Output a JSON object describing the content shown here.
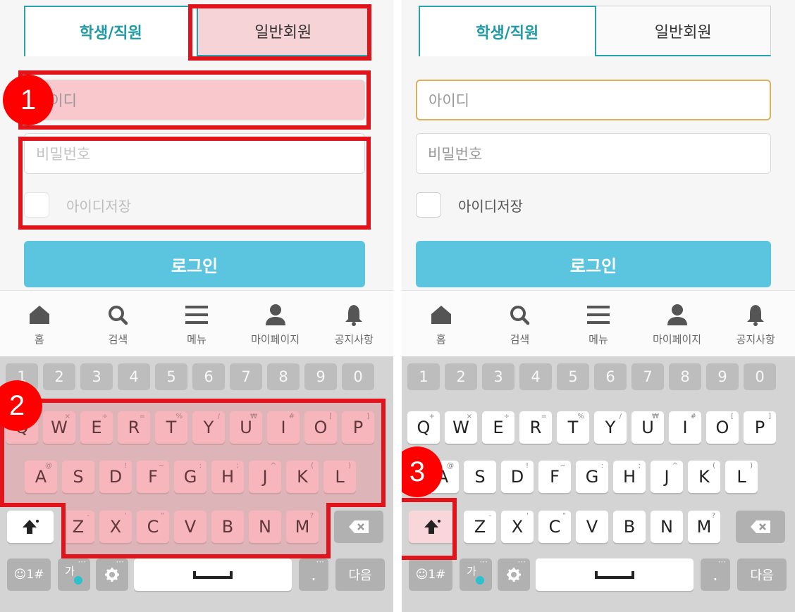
{
  "tabs": {
    "student": "학생/직원",
    "general": "일반회원"
  },
  "login": {
    "id_placeholder": "아이디",
    "pw_placeholder": "비밀번호",
    "save_id_label": "아이디저장",
    "login_button": "로그인"
  },
  "nav": [
    {
      "label": "홈",
      "icon": "home-icon"
    },
    {
      "label": "검색",
      "icon": "search-icon"
    },
    {
      "label": "메뉴",
      "icon": "menu-icon"
    },
    {
      "label": "마이페이지",
      "icon": "person-icon"
    },
    {
      "label": "공지사항",
      "icon": "bell-icon"
    }
  ],
  "keyboard": {
    "numbers": [
      "1",
      "2",
      "3",
      "4",
      "5",
      "6",
      "7",
      "8",
      "9",
      "0"
    ],
    "row1": [
      "Q",
      "W",
      "E",
      "R",
      "T",
      "Y",
      "U",
      "I",
      "O",
      "P"
    ],
    "row1_hints": [
      "+",
      "×",
      "÷",
      "=",
      "%",
      "/",
      "₩",
      "#",
      "[",
      "]"
    ],
    "row2": [
      "A",
      "S",
      "D",
      "F",
      "G",
      "H",
      "J",
      "K",
      "L"
    ],
    "row2_hints": [
      "@",
      "",
      "!",
      "~",
      ":",
      ";",
      "^",
      "(",
      ")"
    ],
    "row3": [
      "Z",
      "X",
      "C",
      "V",
      "B",
      "N",
      "M"
    ],
    "row3_hints": [
      "-",
      "'",
      "\"",
      "",
      "",
      "",
      "?"
    ],
    "symbols_label": "☺1#",
    "lang_label": "가",
    "next_label": "다음",
    "period_label": "."
  },
  "annotations": {
    "step1": "1",
    "step2": "2",
    "step3": "3"
  },
  "colors": {
    "accent": "#2aa1ae",
    "login_button": "#5bc5e0",
    "highlight": "#e1131b",
    "focus_border": "#d8b35a"
  }
}
